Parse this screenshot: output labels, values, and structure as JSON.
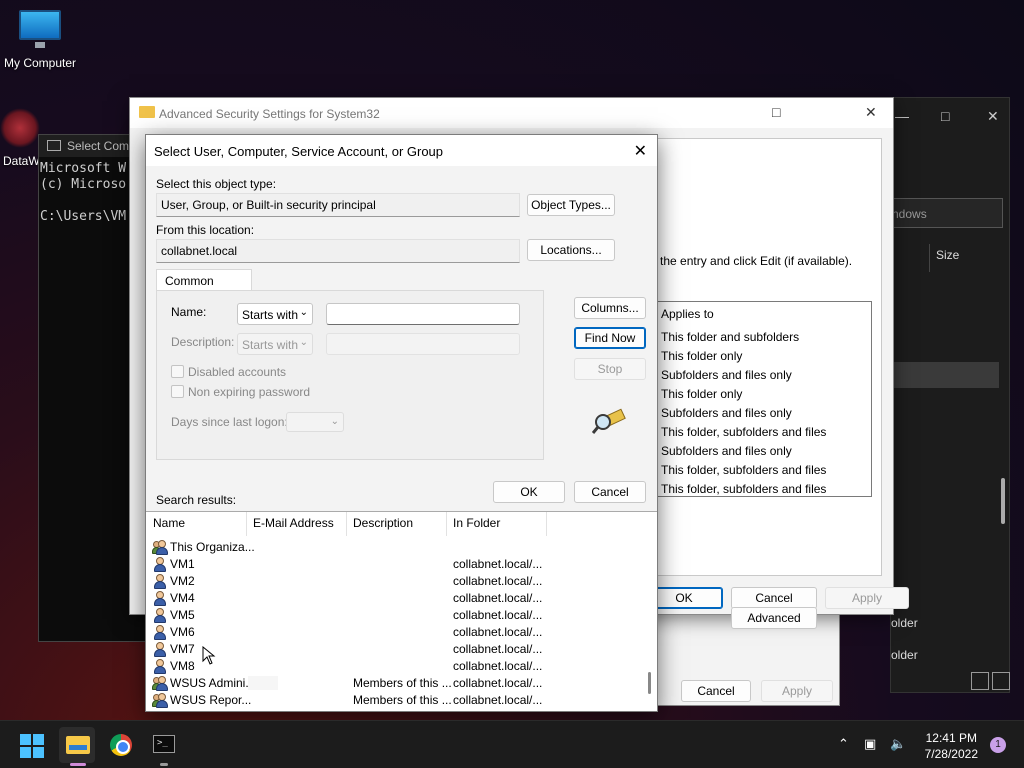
{
  "desktop": {
    "my_computer_label": "My Computer",
    "datawiz_label": "DataW"
  },
  "console": {
    "title": "Select Com",
    "lines": "Microsoft W\n(c) Microso\n\nC:\\Users\\VM"
  },
  "dark_window": {
    "search_placeholder": "ndows",
    "size_col": "Size",
    "folder1": "older",
    "folder2": "older"
  },
  "adv_window": {
    "title": "Advanced Security Settings for System32",
    "hint": "the entry and click Edit (if available).",
    "applies_header": "Applies to",
    "applies_rows": [
      "This folder and subfolders",
      "This folder only",
      "Subfolders and files only",
      "This folder only",
      "Subfolders and files only",
      "This folder, subfolders and files",
      "Subfolders and files only",
      "This folder, subfolders and files",
      "This folder, subfolders and files"
    ],
    "ok": "OK",
    "cancel": "Cancel",
    "apply": "Apply",
    "advanced": "Advanced"
  },
  "perm_window": {
    "cancel": "Cancel",
    "apply": "Apply"
  },
  "select_dialog": {
    "title": "Select User, Computer, Service Account, or Group",
    "object_type_label": "Select this object type:",
    "object_type_value": "User, Group, or Built-in security principal",
    "object_types_button": "Object Types...",
    "location_label": "From this location:",
    "location_value": "collabnet.local",
    "locations_button": "Locations...",
    "tab_common_queries": "Common Queries",
    "name_label": "Name:",
    "name_mode": "Starts with",
    "name_value": "",
    "description_label": "Description:",
    "description_mode": "Starts with",
    "disabled_accounts": "Disabled accounts",
    "non_expiring_password": "Non expiring password",
    "days_since_logon": "Days since last logon:",
    "columns_button": "Columns...",
    "find_now_button": "Find Now",
    "stop_button": "Stop",
    "search_results_label": "Search results:",
    "ok": "OK",
    "cancel": "Cancel",
    "columns": [
      "Name",
      "E-Mail Address",
      "Description",
      "In Folder"
    ],
    "results": [
      {
        "name": "This Organiza...",
        "email": "",
        "description": "",
        "folder": "",
        "kind": "group"
      },
      {
        "name": "VM1",
        "email": "",
        "description": "",
        "folder": "collabnet.local/...",
        "kind": "user"
      },
      {
        "name": "VM2",
        "email": "",
        "description": "",
        "folder": "collabnet.local/...",
        "kind": "user"
      },
      {
        "name": "VM4",
        "email": "",
        "description": "",
        "folder": "collabnet.local/...",
        "kind": "user"
      },
      {
        "name": "VM5",
        "email": "",
        "description": "",
        "folder": "collabnet.local/...",
        "kind": "user"
      },
      {
        "name": "VM6",
        "email": "",
        "description": "",
        "folder": "collabnet.local/...",
        "kind": "user"
      },
      {
        "name": "VM7",
        "email": "",
        "description": "",
        "folder": "collabnet.local/...",
        "kind": "user"
      },
      {
        "name": "VM8",
        "email": "",
        "description": "",
        "folder": "collabnet.local/...",
        "kind": "user"
      },
      {
        "name": "WSUS Admini...",
        "email": "",
        "description": "Members of this ...",
        "folder": "collabnet.local/...",
        "kind": "group"
      },
      {
        "name": "WSUS Repor...",
        "email": "",
        "description": "Members of this ...",
        "folder": "collabnet.local/...",
        "kind": "group"
      }
    ]
  },
  "taskbar": {
    "time": "12:41 PM",
    "date": "7/28/2022",
    "notification_count": "1",
    "colors": {
      "accent": "#4cc2ff",
      "explorer_indicator": "#d08cd8"
    }
  }
}
